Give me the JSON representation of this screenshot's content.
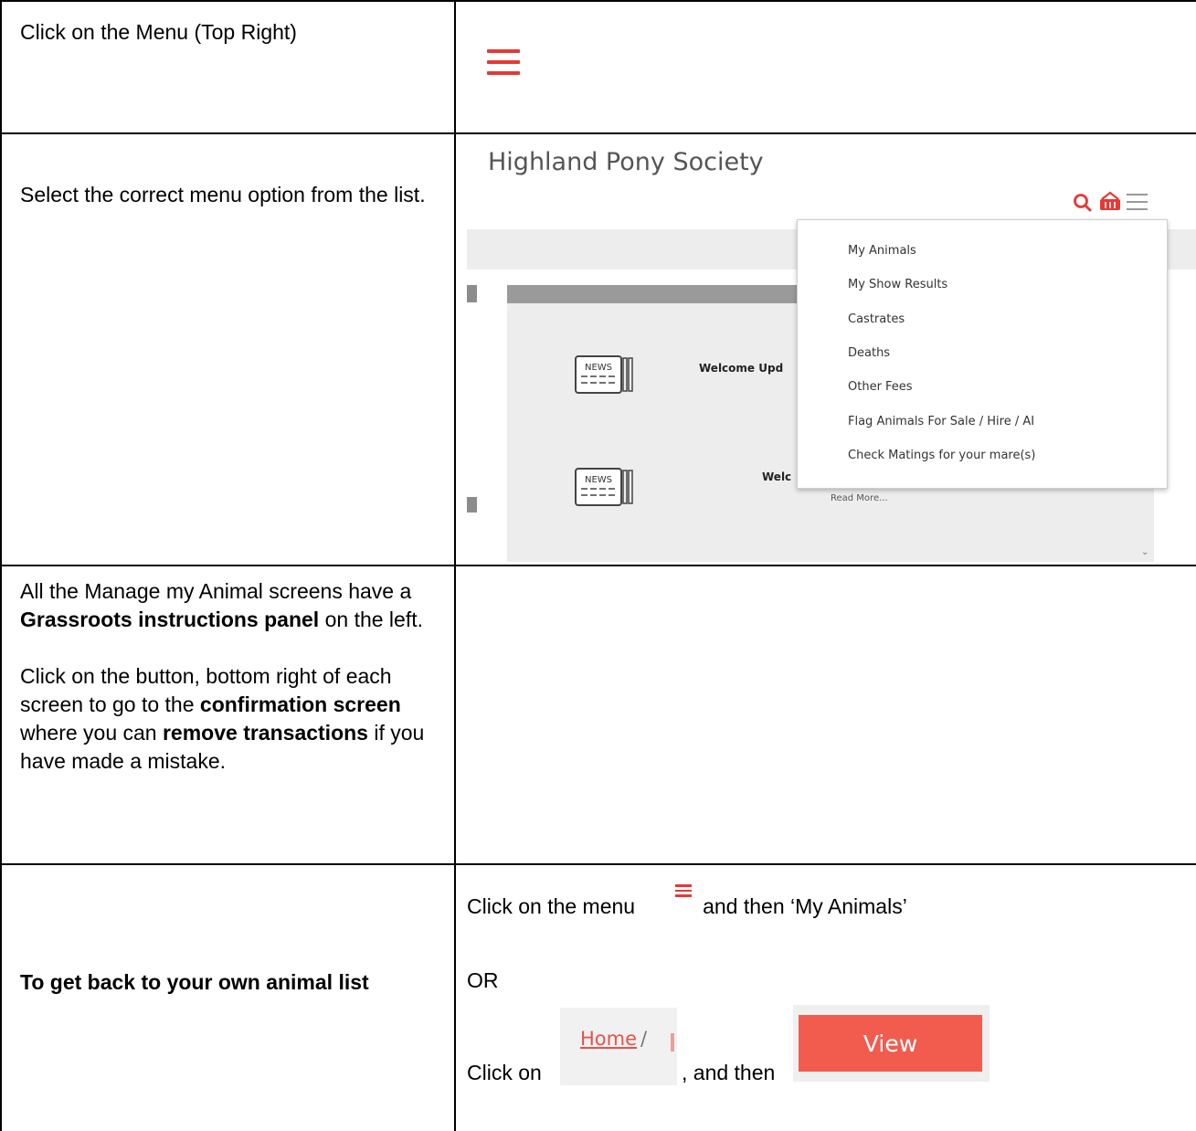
{
  "row1": {
    "instruction": "Click on the Menu (Top Right)"
  },
  "row2": {
    "instruction": "Select the correct menu option from the list.",
    "screenshot": {
      "site_title": "Highland Pony Society",
      "menu_items": [
        "My Animals",
        "My Show Results",
        "Castrates",
        "Deaths",
        "Other Fees",
        "Flag Animals For Sale / Hire / AI",
        "Check Matings for your mare(s)"
      ],
      "news_items": [
        {
          "icon": "NEWS",
          "text": "Welcome Upd"
        },
        {
          "icon": "NEWS",
          "text": "Welc"
        }
      ],
      "read_more": "Read More...",
      "accent_color": "#e53935"
    }
  },
  "row3": {
    "para1": {
      "before": "All the Manage my Animal screens have a ",
      "bold": "Grassroots instructions panel",
      "after": " on the left."
    },
    "para2": {
      "t1": "Click on the button, bottom right of each screen to go to the ",
      "b1": "confirmation screen",
      "t2": " where you can ",
      "b2": "remove transactions",
      "t3": " if you have made a mistake."
    }
  },
  "row4": {
    "left": "To get back to your own animal list",
    "line1_before": "Click on the menu",
    "line1_after": "and then ‘My Animals’",
    "or": "OR",
    "click_on": "Click on",
    "and_then": ", and then",
    "breadcrumb_home": "Home",
    "breadcrumb_sep": "/",
    "view_button": "View"
  }
}
